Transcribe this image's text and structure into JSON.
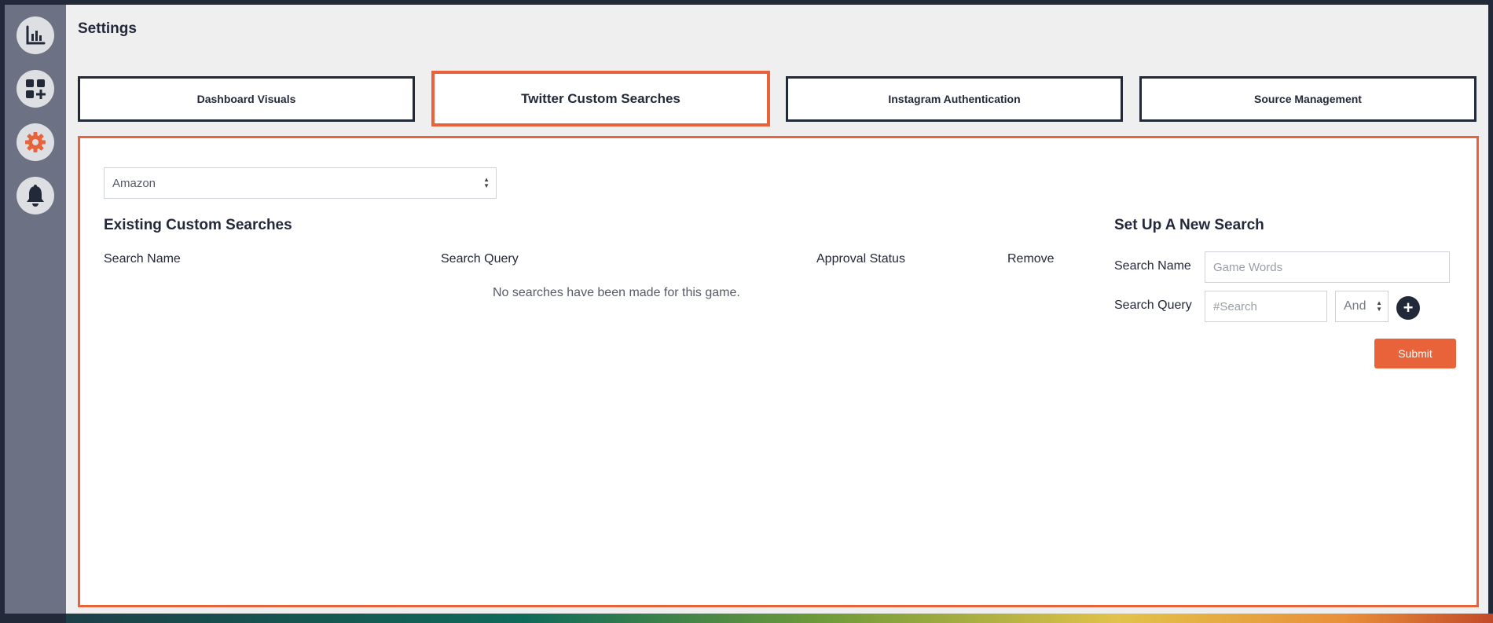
{
  "sidebar": {
    "items": [
      {
        "icon": "bar-chart-icon",
        "label": ""
      },
      {
        "icon": "add-widget-icon",
        "label": ""
      },
      {
        "icon": "gear-icon",
        "label": "",
        "active": true
      },
      {
        "icon": "bell-icon",
        "label": ""
      }
    ],
    "colors": {
      "background": "#6c7184",
      "active_icon": "#e8623a",
      "icon": "#222a3a"
    }
  },
  "page": {
    "title": "Settings"
  },
  "tabs": [
    {
      "label": "Dashboard Visuals",
      "active": false
    },
    {
      "label": "Twitter Custom Searches",
      "active": true
    },
    {
      "label": "Instagram Authentication",
      "active": false
    },
    {
      "label": "Source Management",
      "active": false
    }
  ],
  "game_select": {
    "value": "Amazon"
  },
  "existing": {
    "title": "Existing Custom Searches",
    "columns": [
      "Search Name",
      "Search Query",
      "Approval Status",
      "Remove"
    ],
    "empty_message": "No searches have been made for this game."
  },
  "new_search": {
    "title": "Set Up A New Search",
    "name_label": "Search Name",
    "name_placeholder": "Game Words",
    "query_label": "Search Query",
    "query_placeholder": "#Search",
    "operator": "And",
    "add_label": "+",
    "submit_label": "Submit"
  },
  "colors": {
    "accent": "#e8623a",
    "dark": "#222a3a",
    "panel_bg": "#efefef"
  }
}
